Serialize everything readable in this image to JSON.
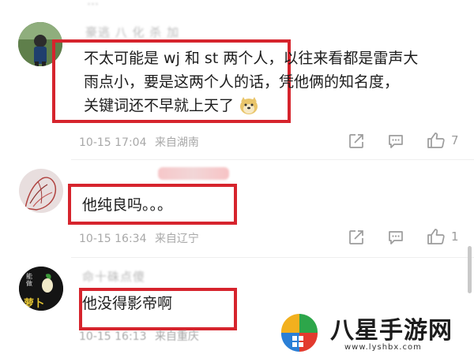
{
  "comments": [
    {
      "username": "豪逃 八 化 杀 加",
      "lines": [
        "不太可能是 wj 和 st 两个人，以往来看都是雷声大",
        "雨点小，要是这两个人的话，凭他俩的知名度，",
        "关键词还不早就上天了"
      ],
      "time": "10-15 17:04",
      "location": "来自湖南",
      "likes": "7"
    },
    {
      "username": "",
      "lines": [
        "他纯良吗。。。"
      ],
      "time": "10-15 16:34",
      "location": "来自辽宁",
      "likes": "1"
    },
    {
      "username": "命十硃点傻",
      "lines": [
        "他没得影帝啊"
      ],
      "time": "10-15 16:13",
      "location": "来自重庆",
      "likes": ""
    }
  ],
  "avatar3_text": [
    "能",
    "做",
    "萝",
    "卜"
  ],
  "watermark": {
    "name": "八星手游网",
    "url": "www.lyshbx.com"
  },
  "colors": {
    "highlight_box": "#d6242d",
    "meta_text": "#a8a8a8",
    "icon": "#9c9c9c"
  }
}
